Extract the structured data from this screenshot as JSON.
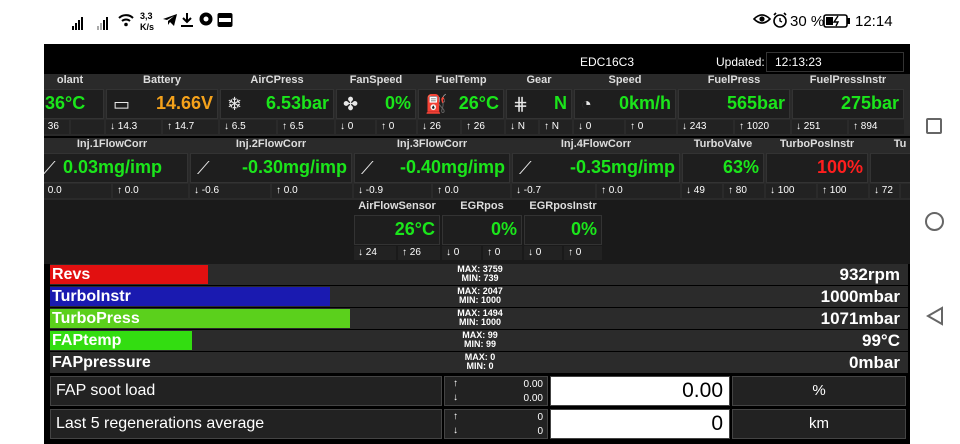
{
  "status_bar": {
    "speed_top": "3,3",
    "speed_unit": "K/s",
    "battery": "30 %",
    "time": "12:14",
    "icons": [
      "signal-icon",
      "signal-icon",
      "wifi-icon",
      "telegram-icon",
      "download-icon",
      "chrome-icon",
      "ebay-icon",
      "eye-icon",
      "alarm-icon",
      "battery-icon"
    ]
  },
  "header": {
    "ecu": "EDC16C3",
    "updated_label": "Updated:",
    "updated_time": "12:13:23"
  },
  "gauges_row1": [
    {
      "title": "olant",
      "value": "36°C",
      "min": "36",
      "max": "",
      "color": "#1be51b",
      "icon": ""
    },
    {
      "title": "Battery",
      "value": "14.66V",
      "min": "14.3",
      "max": "14.7",
      "color": "#f5a21b",
      "icon": "battery-icon"
    },
    {
      "title": "AirCPress",
      "value": "6.53bar",
      "min": "6.5",
      "max": "6.5",
      "color": "#1be51b",
      "icon": "snowflake-icon"
    },
    {
      "title": "FanSpeed",
      "value": "0%",
      "min": "0",
      "max": "0",
      "color": "#1be51b",
      "icon": "fan-icon"
    },
    {
      "title": "FuelTemp",
      "value": "26°C",
      "min": "26",
      "max": "26",
      "color": "#1be51b",
      "icon": "fuel-pump-icon"
    },
    {
      "title": "Gear",
      "value": "N",
      "min": "N",
      "max": "N",
      "color": "#1be51b",
      "icon": "gear-shift-icon"
    },
    {
      "title": "Speed",
      "value": "0km/h",
      "min": "0",
      "max": "0",
      "color": "#1be51b",
      "icon": "speedometer-icon"
    },
    {
      "title": "FuelPress",
      "value": "565bar",
      "min": "243",
      "max": "1020",
      "color": "#1be51b",
      "icon": ""
    },
    {
      "title": "FuelPressInstr",
      "value": "275bar",
      "min": "251",
      "max": "894",
      "color": "#1be51b",
      "icon": ""
    }
  ],
  "gauges_row2": [
    {
      "title": "Inj.1FlowCorr",
      "value": "0.03mg/imp",
      "min": "0.0",
      "max": "0.0",
      "color": "#1be51b",
      "icon": "injector-icon"
    },
    {
      "title": "Inj.2FlowCorr",
      "value": "-0.30mg/imp",
      "min": "-0.6",
      "max": "0.0",
      "color": "#1be51b",
      "icon": "injector-icon"
    },
    {
      "title": "Inj.3FlowCorr",
      "value": "-0.40mg/imp",
      "min": "-0.9",
      "max": "0.0",
      "color": "#1be51b",
      "icon": "injector-icon"
    },
    {
      "title": "Inj.4FlowCorr",
      "value": "-0.35mg/imp",
      "min": "-0.7",
      "max": "0.0",
      "color": "#1be51b",
      "icon": "injector-icon"
    },
    {
      "title": "TurboValve",
      "value": "63%",
      "min": "49",
      "max": "80",
      "color": "#1be51b",
      "icon": ""
    },
    {
      "title": "TurboPosInstr",
      "value": "100%",
      "min": "100",
      "max": "100",
      "color": "#ff1e1e",
      "icon": ""
    },
    {
      "title": "Tu",
      "value": "",
      "min": "72",
      "max": "",
      "color": "#1be51b",
      "icon": ""
    }
  ],
  "gauges_row3": [
    {
      "title": "AirFlowSensor",
      "value": "26°C",
      "min": "24",
      "max": "26",
      "color": "#1be51b"
    },
    {
      "title": "EGRpos",
      "value": "0%",
      "min": "0",
      "max": "0",
      "color": "#1be51b"
    },
    {
      "title": "EGRposInstr",
      "value": "0%",
      "min": "0",
      "max": "0",
      "color": "#1be51b"
    }
  ],
  "bars": [
    {
      "name": "Revs",
      "max": "MAX: 3759",
      "min": "MIN: 739",
      "value": "932rpm",
      "fill": 0.39,
      "color": "#e21010"
    },
    {
      "name": "TurboInstr",
      "max": "MAX: 2047",
      "min": "MIN: 1000",
      "value": "1000mbar",
      "fill": 0.69,
      "color": "#1a1ab0"
    },
    {
      "name": "TurboPress",
      "max": "MAX: 1494",
      "min": "MIN: 1000",
      "value": "1071mbar",
      "fill": 0.74,
      "color": "#5bd01c"
    },
    {
      "name": "FAPtemp",
      "max": "MAX: 99",
      "min": "MIN: 99",
      "value": "99°C",
      "fill": 0.35,
      "color": "#33dd11"
    },
    {
      "name": "FAPpressure",
      "max": "MAX: 0",
      "min": "MIN: 0",
      "value": "0mbar",
      "fill": 0.0,
      "color": "#33dd11"
    }
  ],
  "table": [
    {
      "name": "FAP soot load",
      "up": "0.00",
      "down": "0.00",
      "value": "0.00",
      "unit": "%"
    },
    {
      "name": "Last 5 regenerations average",
      "up": "0",
      "down": "0",
      "value": "0",
      "unit": "km"
    }
  ],
  "arrows": {
    "up": "↑",
    "down": "↓",
    "max": "↑",
    "min": "↓"
  }
}
